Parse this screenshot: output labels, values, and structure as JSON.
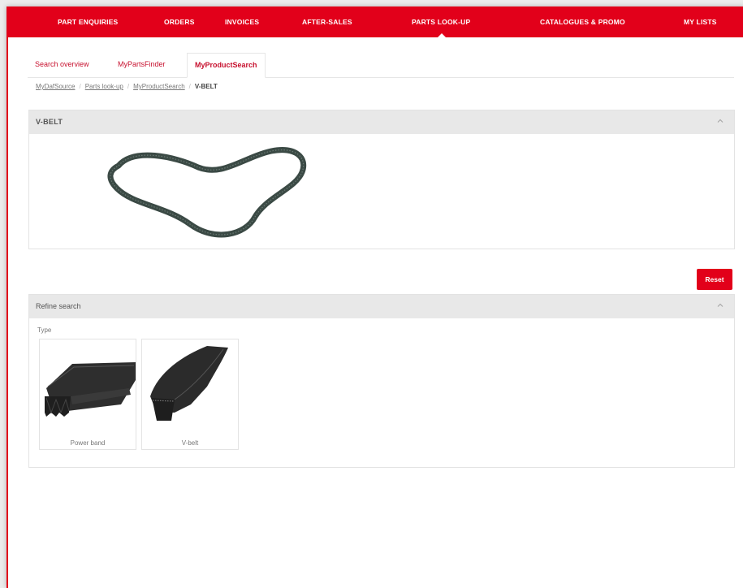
{
  "top_nav": {
    "items": [
      {
        "label": "PART ENQUIRIES"
      },
      {
        "label": "ORDERS"
      },
      {
        "label": "INVOICES"
      },
      {
        "label": "AFTER-SALES"
      },
      {
        "label": "PARTS LOOK-UP",
        "active": true
      },
      {
        "label": "CATALOGUES & PROMO"
      },
      {
        "label": "MY LISTS"
      }
    ]
  },
  "tabs": [
    {
      "label": "Search overview"
    },
    {
      "label": "MyPartsFinder"
    },
    {
      "label": "MyProductSearch",
      "active": true
    }
  ],
  "breadcrumb": {
    "items": [
      "MyDafSource",
      "Parts look-up",
      "MyProductSearch"
    ],
    "current": "V-BELT"
  },
  "product_panel": {
    "title": "V-BELT",
    "image_icon": "v-belt-loop-image"
  },
  "reset_button": {
    "label": "Reset"
  },
  "refine_panel": {
    "title": "Refine search",
    "type_label": "Type",
    "types": [
      {
        "label": "Power band",
        "icon": "power-band-image"
      },
      {
        "label": "V-belt",
        "icon": "v-belt-image"
      }
    ]
  },
  "colors": {
    "brand_red": "#e2001a",
    "panel_header": "#e8e8e8",
    "link_red": "#c7102e"
  }
}
